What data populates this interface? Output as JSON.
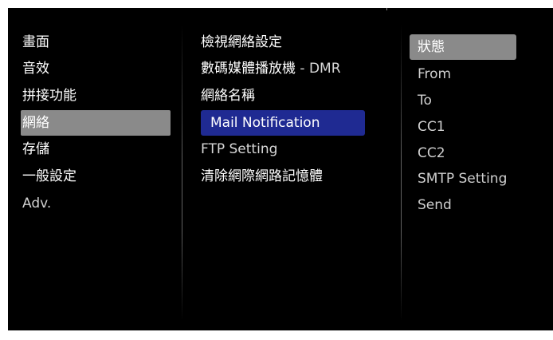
{
  "menu_main": {
    "items": [
      {
        "label": "畫面"
      },
      {
        "label": "音效"
      },
      {
        "label": "拼接功能"
      },
      {
        "label": "網絡"
      },
      {
        "label": "存儲"
      },
      {
        "label": "一般設定"
      },
      {
        "label": "Adv."
      }
    ],
    "selected_index": 3
  },
  "menu_network": {
    "items": [
      {
        "label": "檢視網絡設定"
      },
      {
        "label": "數碼媒體播放機",
        "suffix": " - DMR"
      },
      {
        "label": "網絡名稱"
      },
      {
        "label": "Mail Notification"
      },
      {
        "label": "FTP Setting"
      },
      {
        "label": "清除網際網路記憶體"
      }
    ],
    "highlighted_index": 3
  },
  "menu_mail": {
    "items": [
      {
        "label": "狀態"
      },
      {
        "label": "From"
      },
      {
        "label": "To"
      },
      {
        "label": "CC1"
      },
      {
        "label": "CC2"
      },
      {
        "label": "SMTP Setting"
      },
      {
        "label": "Send"
      }
    ],
    "focused_index": 0
  },
  "colors": {
    "background": "#000000",
    "selection_gray": "#8a8a8a",
    "highlight_blue": "#1f2a92",
    "text": "#ffffff"
  }
}
